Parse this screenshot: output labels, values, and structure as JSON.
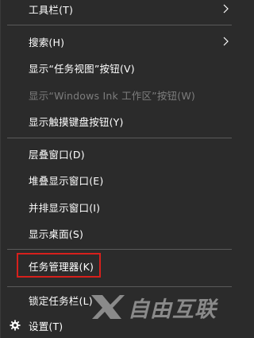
{
  "menu": {
    "items": [
      {
        "label": "工具栏(T)",
        "has_submenu": true,
        "disabled": false
      },
      {
        "label": "搜索(H)",
        "has_submenu": true,
        "disabled": false
      },
      {
        "label": "显示“任务视图”按钮(V)",
        "has_submenu": false,
        "disabled": false
      },
      {
        "label": "显示“Windows Ink 工作区”按钮(W)",
        "has_submenu": false,
        "disabled": true
      },
      {
        "label": "显示触摸键盘按钮(Y)",
        "has_submenu": false,
        "disabled": false
      },
      {
        "label": "层叠窗口(D)",
        "has_submenu": false,
        "disabled": false
      },
      {
        "label": "堆叠显示窗口(E)",
        "has_submenu": false,
        "disabled": false
      },
      {
        "label": "并排显示窗口(I)",
        "has_submenu": false,
        "disabled": false
      },
      {
        "label": "显示桌面(S)",
        "has_submenu": false,
        "disabled": false
      },
      {
        "label": "任务管理器(K)",
        "has_submenu": false,
        "disabled": false,
        "highlighted": true
      },
      {
        "label": "锁定任务栏(L)",
        "has_submenu": false,
        "disabled": false
      },
      {
        "label": "设置(T)",
        "has_submenu": false,
        "disabled": false,
        "icon": "gear-icon"
      }
    ]
  },
  "colors": {
    "background": "#2b2b2b",
    "text": "#ffffff",
    "disabled_text": "#7d7d7d",
    "separator": "#5a5a5a",
    "highlight_border": "#d6201c"
  },
  "watermark": {
    "text": "自由互联",
    "logo_icon": "x-logo-icon"
  }
}
